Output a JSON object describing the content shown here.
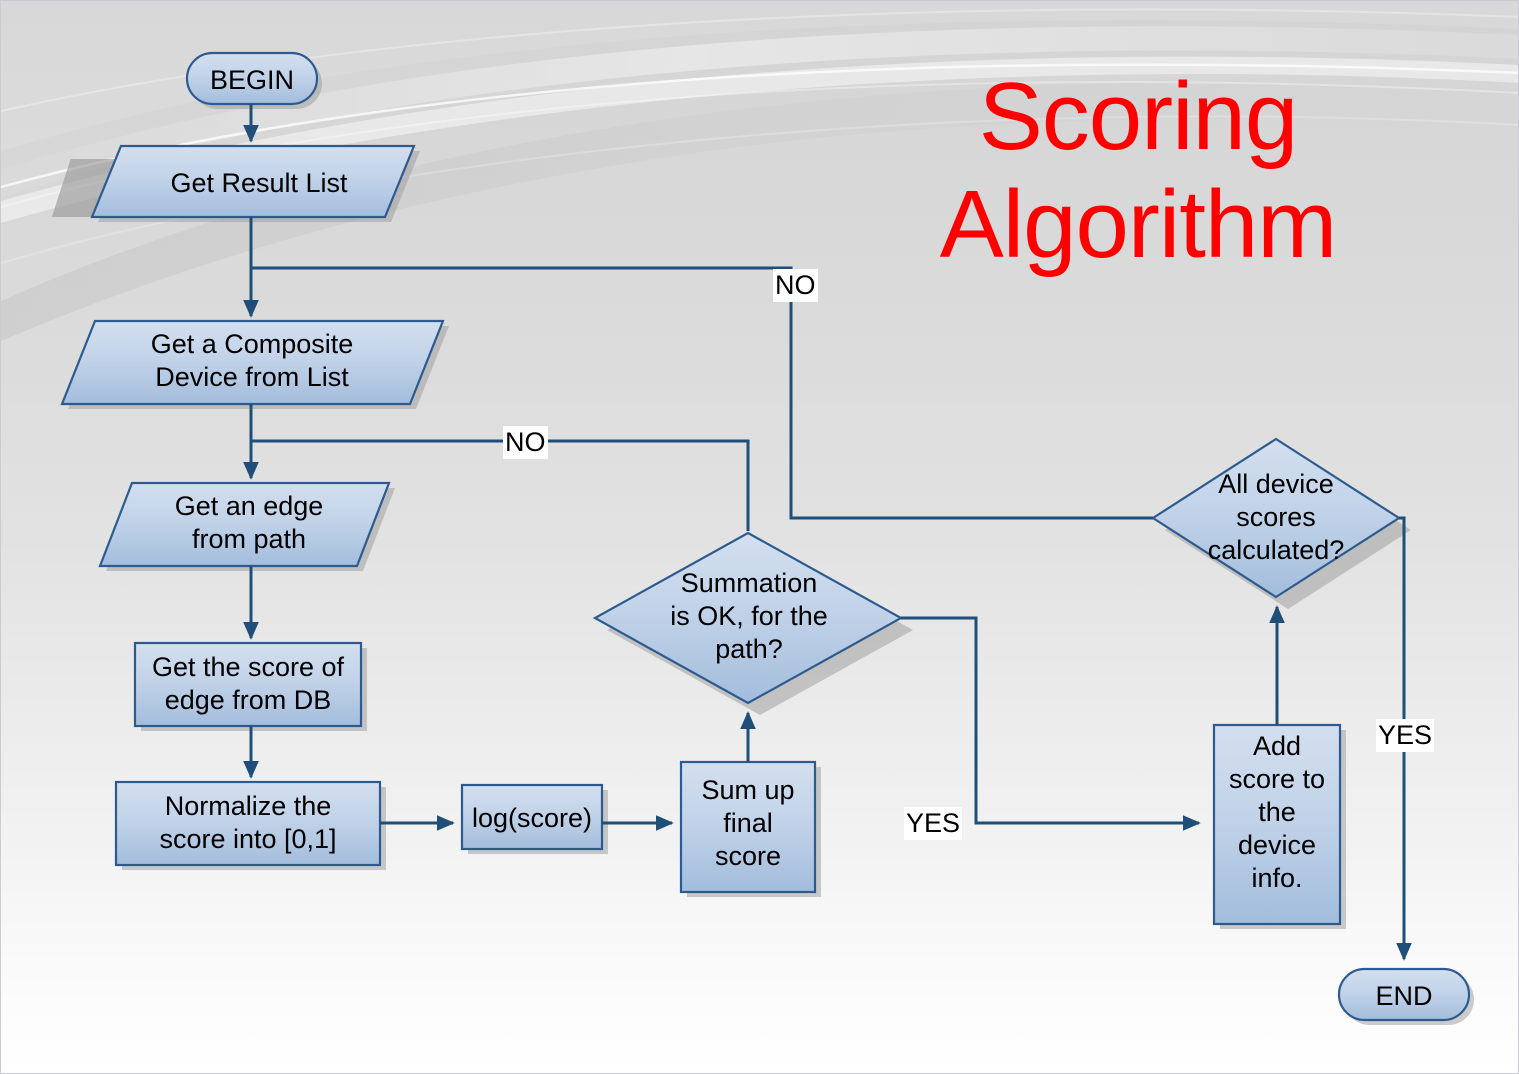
{
  "slide": {
    "title_line1": "Scoring",
    "title_line2": "Algorithm",
    "title_color": "#ff0000",
    "background_top": "#d4d4d4",
    "background_bottom": "#ffffff"
  },
  "style": {
    "shape_fill_top": "#cfdcee",
    "shape_fill_bottom": "#a5bedd",
    "shape_stroke": "#2e5b8f",
    "connector_color": "#1f4e79",
    "text_color": "#000000"
  },
  "nodes": [
    {
      "id": "begin",
      "shape": "terminator",
      "label": "BEGIN"
    },
    {
      "id": "get-result-list",
      "shape": "parallelogram",
      "label": "Get Result List"
    },
    {
      "id": "get-composite-device",
      "shape": "parallelogram",
      "label": "Get a Composite\nDevice from List"
    },
    {
      "id": "get-edge-from-path",
      "shape": "parallelogram",
      "label": "Get an edge\nfrom path"
    },
    {
      "id": "get-score-of-edge",
      "shape": "process",
      "label": "Get the score of\nedge from DB"
    },
    {
      "id": "normalize-score",
      "shape": "process",
      "label": "Normalize the\nscore into [0,1]"
    },
    {
      "id": "log-score",
      "shape": "process",
      "label": "log(score)"
    },
    {
      "id": "sum-up-final-score",
      "shape": "process",
      "label": "Sum up\nfinal\nscore"
    },
    {
      "id": "summation-ok",
      "shape": "decision",
      "label": "Summation\nis OK, for the\npath?"
    },
    {
      "id": "all-device-scores",
      "shape": "decision",
      "label": "All device\nscores\ncalculated?"
    },
    {
      "id": "add-score-to-device",
      "shape": "process",
      "label": "Add\nscore to\nthe\ndevice\ninfo."
    },
    {
      "id": "end",
      "shape": "terminator",
      "label": "END"
    }
  ],
  "edge_labels": {
    "no_device_loop": "NO",
    "no_path_loop": "NO",
    "yes_summation": "YES",
    "yes_all_scores": "YES"
  },
  "edges": [
    {
      "from": "begin",
      "to": "get-result-list",
      "label": ""
    },
    {
      "from": "get-result-list",
      "to": "get-composite-device",
      "label": ""
    },
    {
      "from": "get-composite-device",
      "to": "get-edge-from-path",
      "label": ""
    },
    {
      "from": "get-edge-from-path",
      "to": "get-score-of-edge",
      "label": ""
    },
    {
      "from": "get-score-of-edge",
      "to": "normalize-score",
      "label": ""
    },
    {
      "from": "normalize-score",
      "to": "log-score",
      "label": ""
    },
    {
      "from": "log-score",
      "to": "sum-up-final-score",
      "label": ""
    },
    {
      "from": "sum-up-final-score",
      "to": "summation-ok",
      "label": ""
    },
    {
      "from": "summation-ok",
      "to": "get-edge-from-path",
      "label": "NO"
    },
    {
      "from": "summation-ok",
      "to": "add-score-to-device",
      "label": "YES"
    },
    {
      "from": "add-score-to-device",
      "to": "all-device-scores",
      "label": ""
    },
    {
      "from": "all-device-scores",
      "to": "get-composite-device",
      "label": "NO"
    },
    {
      "from": "all-device-scores",
      "to": "end",
      "label": "YES"
    }
  ]
}
